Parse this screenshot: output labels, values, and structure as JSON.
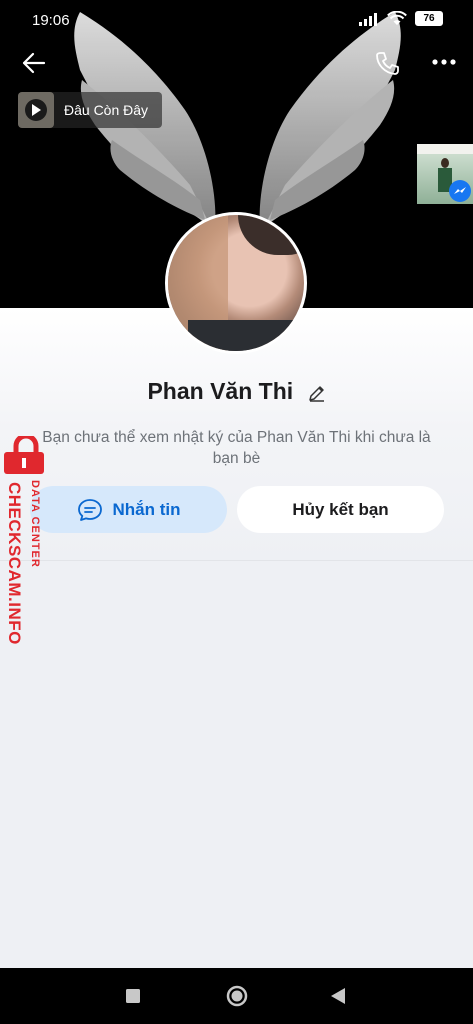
{
  "status_bar": {
    "time": "19:06",
    "battery": "76"
  },
  "cover": {
    "music_title": "Đâu Còn Đây"
  },
  "profile": {
    "name": "Phan Văn Thi",
    "notice": "Bạn chưa thể xem nhật ký của Phan Văn Thi khi chưa là bạn bè"
  },
  "actions": {
    "message_label": "Nhắn tin",
    "unfriend_label": "Hủy kết bạn"
  },
  "watermark": {
    "line1": "DATA CENTER",
    "line2": "CHECKSCAM.INFO"
  },
  "colors": {
    "accent": "#0a68d0",
    "message_button_bg": "#d6e8fb",
    "watermark_red": "#e0282e"
  },
  "icons": [
    "back-arrow-icon",
    "phone-icon",
    "more-icon",
    "play-icon",
    "edit-pencil-icon",
    "chat-bubble-icon",
    "messenger-icon",
    "lock-icon",
    "nav-recents-icon",
    "nav-home-icon",
    "nav-back-icon"
  ]
}
